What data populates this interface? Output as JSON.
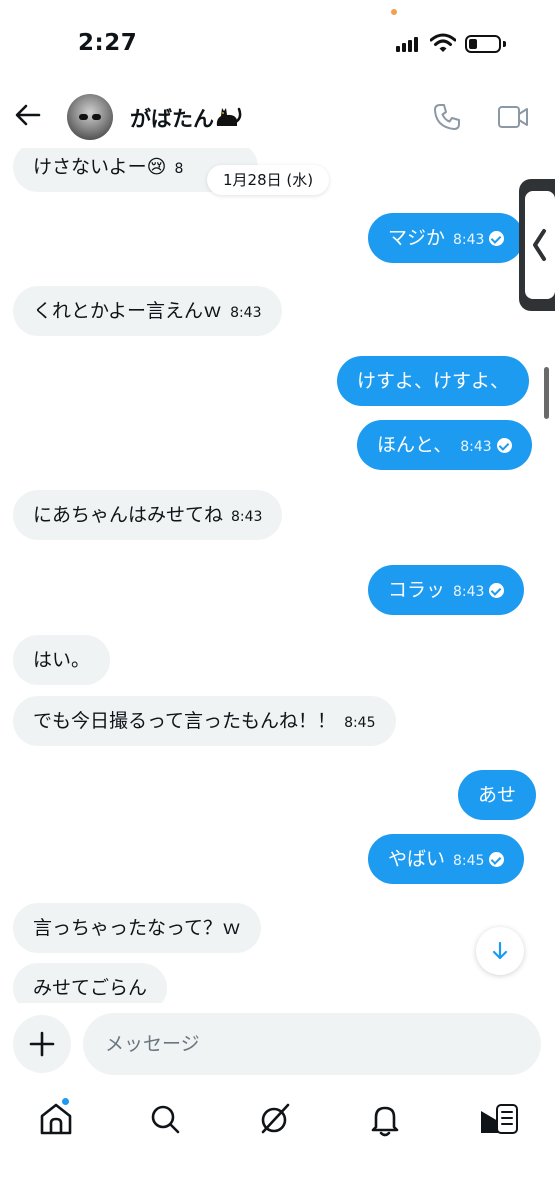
{
  "status_bar": {
    "time": "2:27"
  },
  "header": {
    "contact_name": "がばたん"
  },
  "date_chip": "1月28日 (水)",
  "messages": [
    {
      "text": "けさないよー😢",
      "time": "8",
      "direction": "in"
    },
    {
      "text": "マジか",
      "time": "8:43",
      "direction": "out"
    },
    {
      "text": "くれとかよー言えんｗ",
      "time": "8:43",
      "direction": "in"
    },
    {
      "text": "けすよ、けすよ、",
      "time": "",
      "direction": "out"
    },
    {
      "text": "ほんと、",
      "time": "8:43",
      "direction": "out"
    },
    {
      "text": "にあちゃんはみせてね",
      "time": "8:43",
      "direction": "in"
    },
    {
      "text": "コラッ",
      "time": "8:43",
      "direction": "out"
    },
    {
      "text": "はい。",
      "time": "",
      "direction": "in"
    },
    {
      "text": "でも今日撮るって言ったもんね！！",
      "time": "8:45",
      "direction": "in"
    },
    {
      "text": "あせ",
      "time": "",
      "direction": "out"
    },
    {
      "text": "やばい",
      "time": "8:45",
      "direction": "out"
    },
    {
      "text": "言っちゃったなって？ｗ",
      "time": "",
      "direction": "in"
    },
    {
      "text": "みせてごらん",
      "time": "",
      "direction": "in"
    }
  ],
  "composer": {
    "placeholder": "メッセージ"
  },
  "colors": {
    "accent": "#1d9bf0",
    "incoming_bubble": "#eff3f4",
    "text": "#0f1419"
  },
  "nav": {
    "items": [
      "home-icon",
      "search-icon",
      "grok-icon",
      "notifications-icon",
      "messages-icon"
    ]
  }
}
